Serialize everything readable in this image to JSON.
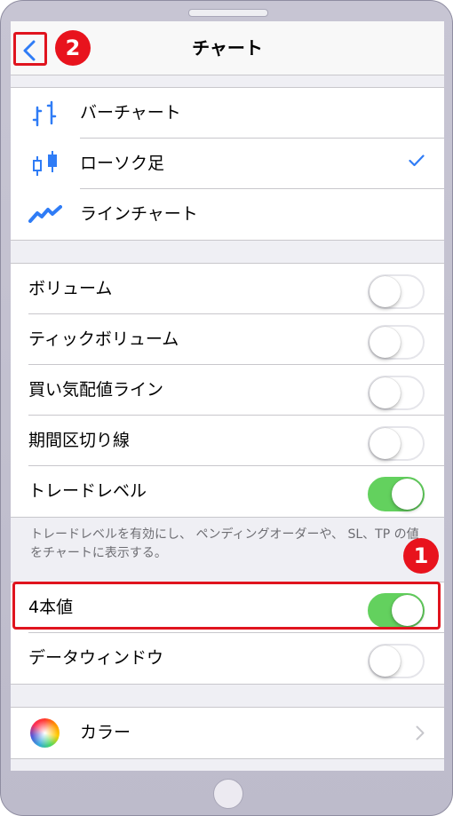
{
  "nav": {
    "title": "チャート",
    "back_icon": "chevron-left-icon"
  },
  "chart_types": [
    {
      "label": "バーチャート",
      "icon": "bar-chart-icon",
      "selected": false
    },
    {
      "label": "ローソク足",
      "icon": "candlestick-icon",
      "selected": true
    },
    {
      "label": "ラインチャート",
      "icon": "line-chart-icon",
      "selected": false
    }
  ],
  "settings": [
    {
      "label": "ボリューム",
      "on": false
    },
    {
      "label": "ティックボリューム",
      "on": false
    },
    {
      "label": "買い気配値ライン",
      "on": false
    },
    {
      "label": "期間区切り線",
      "on": false
    },
    {
      "label": "トレードレベル",
      "on": true
    }
  ],
  "footnote": "トレードレベルを有効にし、 ペンディングオーダーや、 SL、TP の値をチャートに表示する。",
  "settings2": [
    {
      "label": "4本値",
      "on": true
    },
    {
      "label": "データウィンドウ",
      "on": false
    }
  ],
  "color_row": {
    "label": "カラー",
    "icon": "color-wheel-icon"
  },
  "annotations": {
    "marker_1": "1",
    "marker_2": "2"
  },
  "colors": {
    "accent": "#2f7cf6",
    "toggle_on": "#63d15e",
    "annotation": "#e0141e"
  }
}
